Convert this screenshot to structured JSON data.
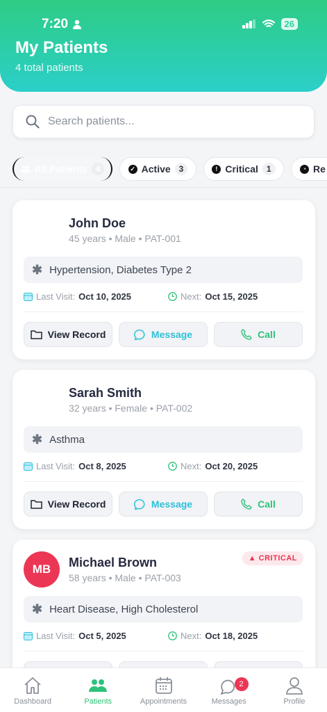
{
  "status_bar": {
    "time": "7:20",
    "battery": "26"
  },
  "header": {
    "title": "My Patients",
    "subtitle": "4 total patients"
  },
  "search": {
    "placeholder": "Search patients...",
    "value": ""
  },
  "filters": [
    {
      "label": "All Patients",
      "count": "4",
      "selected": true
    },
    {
      "label": "Active",
      "count": "3"
    },
    {
      "label": "Critical",
      "count": "1"
    },
    {
      "label": "Re",
      "count": ""
    }
  ],
  "patients": [
    {
      "name": "John Doe",
      "meta": "45 years • Male • PAT-001",
      "initials": "",
      "condition": "Hypertension, Diabetes Type 2",
      "last_visit_label": "Last Visit:",
      "last_visit": "Oct 10, 2025",
      "next_label": "Next:",
      "next": "Oct 15, 2025",
      "badge": ""
    },
    {
      "name": "Sarah Smith",
      "meta": "32 years • Female • PAT-002",
      "initials": "",
      "condition": "Asthma",
      "last_visit_label": "Last Visit:",
      "last_visit": "Oct 8, 2025",
      "next_label": "Next:",
      "next": "Oct 20, 2025",
      "badge": ""
    },
    {
      "name": "Michael Brown",
      "meta": "58 years • Male • PAT-003",
      "initials": "MB",
      "condition": "Heart Disease, High Cholesterol",
      "last_visit_label": "Last Visit:",
      "last_visit": "Oct 5, 2025",
      "next_label": "Next:",
      "next": "Oct 18, 2025",
      "badge": "CRITICAL"
    }
  ],
  "actions": {
    "view": "View Record",
    "message": "Message",
    "call": "Call"
  },
  "nav": [
    {
      "label": "Dashboard",
      "icon": "home-icon"
    },
    {
      "label": "Patients",
      "icon": "users-icon",
      "active": true
    },
    {
      "label": "Appointments",
      "icon": "calendar-icon"
    },
    {
      "label": "Messages",
      "icon": "chat-icon",
      "badge": "2"
    },
    {
      "label": "Profile",
      "icon": "person-icon"
    }
  ],
  "colors": {
    "accent": "#2ec27a",
    "teal": "#2bcfc9",
    "critical": "#ec3656"
  }
}
